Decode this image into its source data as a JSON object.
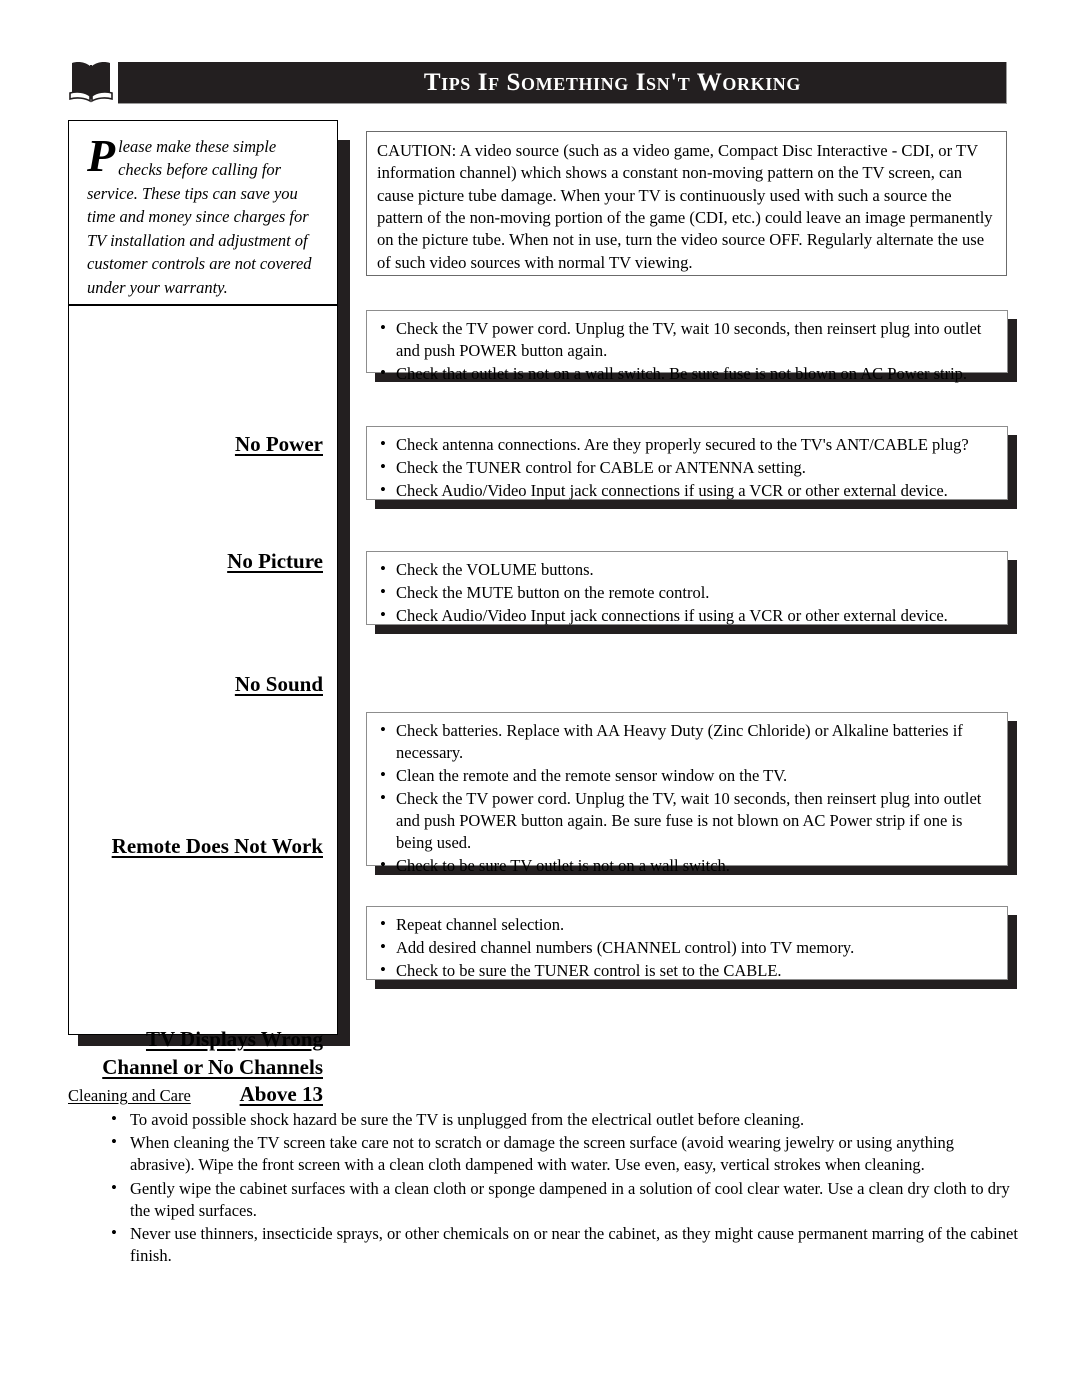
{
  "header": {
    "icon": "open-book-icon",
    "title": "Tips If Something Isn't Working"
  },
  "intro": {
    "dropcap": "P",
    "text": "lease make these simple checks before calling for service.  These tips can save you time and money since charges for TV installation and adjustment of customer controls are not covered under your warranty."
  },
  "caution": {
    "text": "CAUTION: A video source (such as a video game, Compact Disc Interactive - CDI, or TV information channel) which shows a constant non-moving pattern on the TV screen, can cause picture tube damage.  When your TV is continuously used with such a source the pattern of the non-moving portion of the game (CDI, etc.) could leave an image permanently on the picture tube.  When not in use, turn the video source OFF.  Regularly alternate the use of such video sources with normal TV viewing."
  },
  "sections": [
    {
      "label": "No Power",
      "items": [
        "Check the TV power cord.  Unplug the TV, wait 10 seconds, then reinsert plug into outlet and push POWER button again.",
        "Check that outlet is not on a wall switch. Be sure fuse is not blown on AC Power strip."
      ]
    },
    {
      "label": "No Picture",
      "items": [
        "Check antenna connections.  Are they properly secured to the TV's ANT/CABLE plug?",
        "Check the TUNER control for CABLE or ANTENNA setting.",
        "Check Audio/Video Input jack connections if using a VCR or other external device."
      ]
    },
    {
      "label": "No Sound",
      "items": [
        "Check the VOLUME buttons.",
        "Check the MUTE button on the remote control.",
        "Check Audio/Video Input jack connections if using a VCR or other external device."
      ]
    },
    {
      "label": "Remote Does Not Work",
      "items": [
        "Check batteries.  Replace with AA Heavy Duty (Zinc Chloride) or Alkaline batteries if necessary.",
        "Clean the remote and the remote sensor window on the TV.",
        "Check the TV power cord.  Unplug the TV, wait 10 seconds, then reinsert plug into outlet and push POWER button again. Be sure fuse is not blown on AC Power strip if one is being used.",
        "Check to be sure TV outlet is not on a wall switch."
      ]
    },
    {
      "label": "TV Displays Wrong Channel or No Channels Above 13",
      "items": [
        "Repeat channel selection.",
        "Add desired channel numbers (CHANNEL control) into TV memory.",
        "Check to be sure the TUNER control is set to the CABLE."
      ]
    }
  ],
  "care": {
    "title": "Cleaning and Care",
    "items": [
      "To avoid possible shock hazard be sure the TV is unplugged from the electrical outlet before cleaning.",
      "When cleaning the TV screen take care not to scratch or damage the screen surface (avoid wearing jewelry or using anything abrasive).  Wipe the front screen with a clean cloth dampened with water.  Use even, easy, vertical strokes when cleaning.",
      "Gently wipe the cabinet surfaces with a clean cloth or sponge dampened in a solution of cool clear water.  Use a clean dry cloth to dry the wiped surfaces.",
      "Never use thinners, insecticide sprays, or other chemicals on or near the cabinet, as they might cause permanent marring of the cabinet finish."
    ]
  },
  "bullet_glyph": "•",
  "colors": {
    "header_bar": "#231f20",
    "shadow": "#231f20",
    "page_background": "#ffffff"
  }
}
